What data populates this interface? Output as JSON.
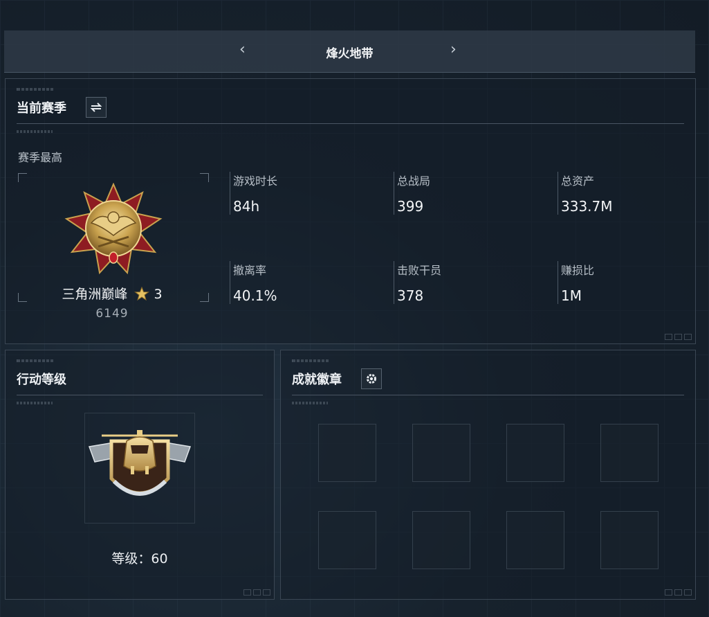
{
  "topbar": {
    "title": "烽火地带",
    "prev_icon": "chevron-left-icon",
    "next_icon": "chevron-right-icon"
  },
  "season_panel": {
    "title": "当前赛季",
    "switch_icon": "swap-arrows-icon",
    "best_label": "赛季最高",
    "rank": {
      "name": "三角洲巅峰",
      "star_icon": "gold-star-icon",
      "stars": "3",
      "score": "6149",
      "emblem_icon": "gold-eagle-medal-icon"
    },
    "stats": [
      {
        "label": "游戏时长",
        "value": "84h"
      },
      {
        "label": "总战局",
        "value": "399"
      },
      {
        "label": "总资产",
        "value": "333.7M"
      },
      {
        "label": "撤离率",
        "value": "40.1%"
      },
      {
        "label": "击败干员",
        "value": "378"
      },
      {
        "label": "赚损比",
        "value": "1M"
      }
    ]
  },
  "level_panel": {
    "title": "行动等级",
    "badge_icon": "helicopter-delta-force-badge-icon",
    "level_text": "等级：60"
  },
  "achievement_panel": {
    "title": "成就徽章",
    "settings_icon": "gear-icon",
    "slot_count": 8
  },
  "colors": {
    "background": "#17222d",
    "panel_border": "#3b4754",
    "gold": "#c9a24e",
    "medal_red": "#8e1c22"
  }
}
